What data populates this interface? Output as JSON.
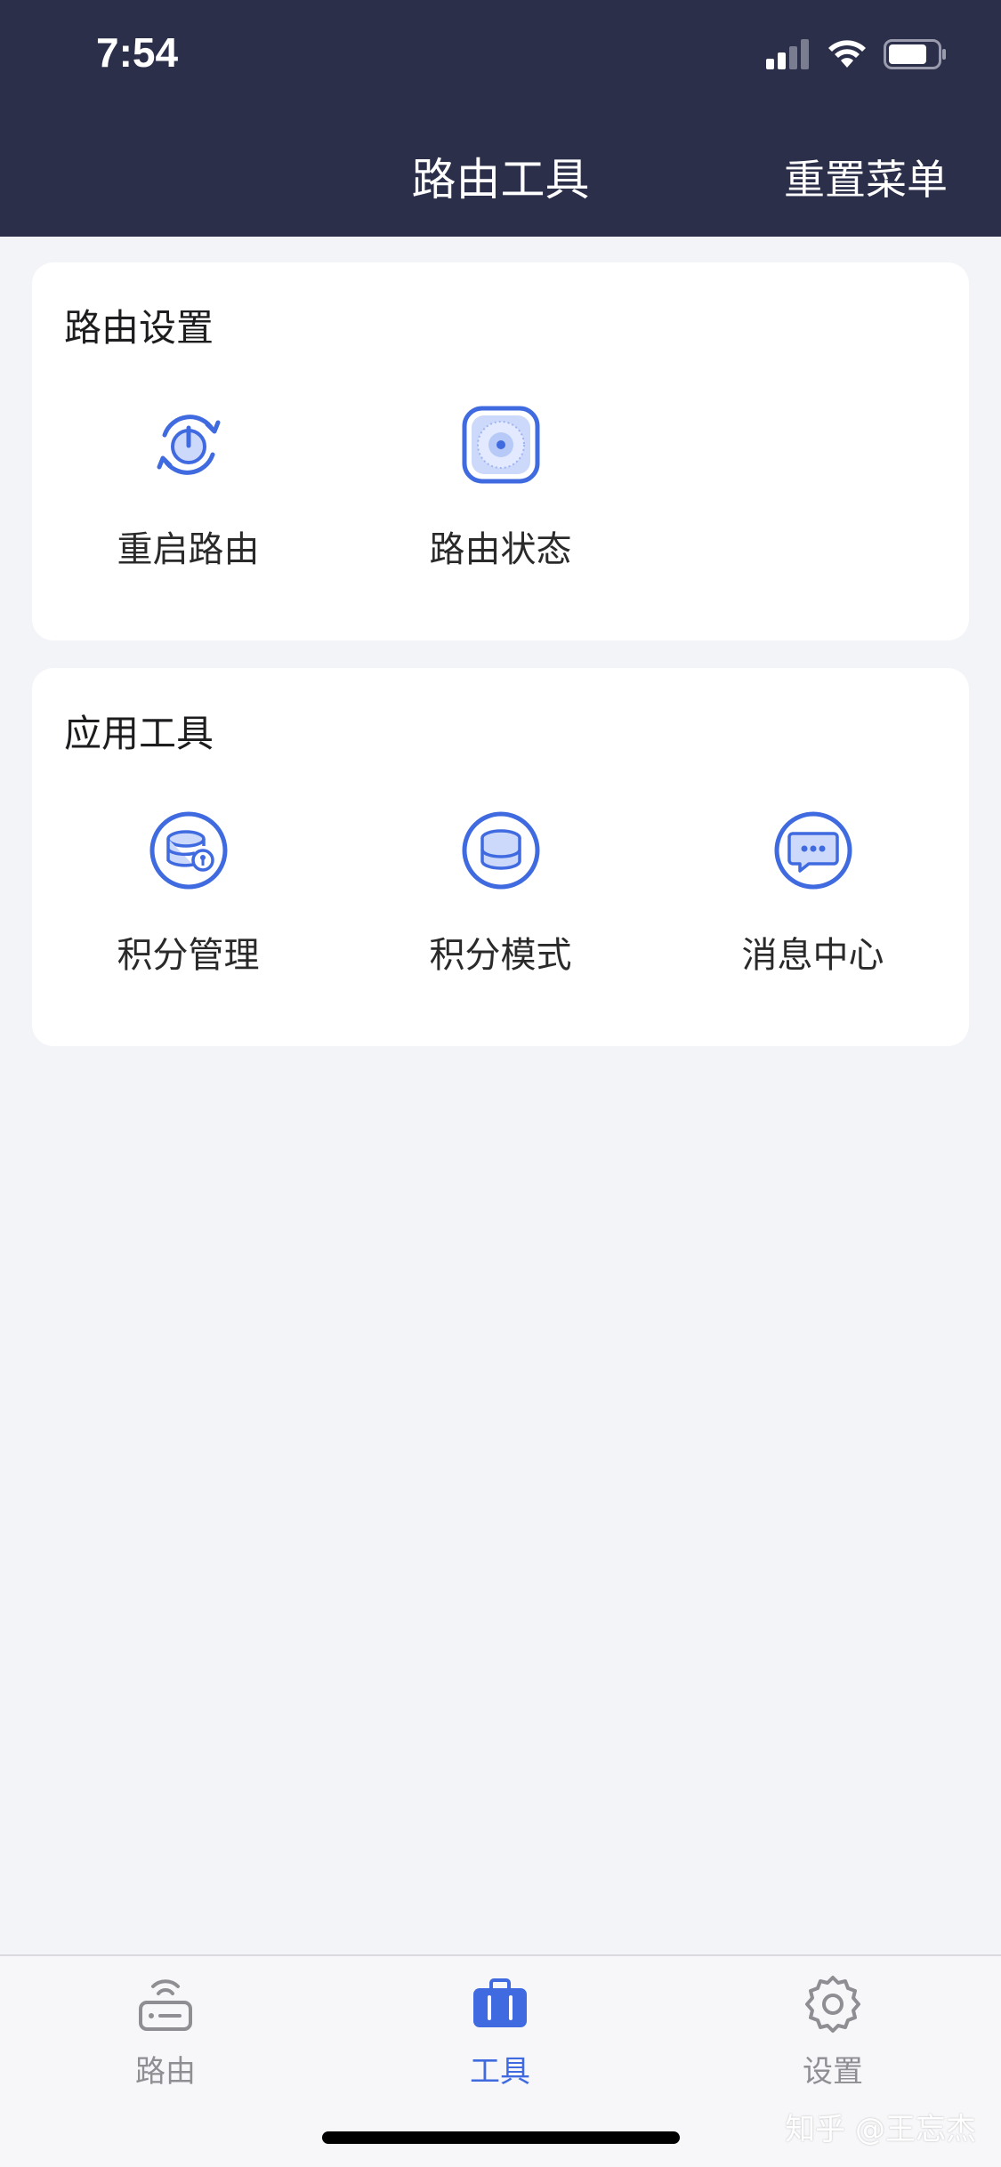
{
  "status_bar": {
    "time": "7:54"
  },
  "nav": {
    "title": "路由工具",
    "right_action": "重置菜单"
  },
  "sections": [
    {
      "title": "路由设置",
      "items": [
        {
          "label": "重启路由",
          "icon": "restart-power-icon"
        },
        {
          "label": "路由状态",
          "icon": "router-status-icon"
        }
      ]
    },
    {
      "title": "应用工具",
      "items": [
        {
          "label": "积分管理",
          "icon": "points-manage-icon"
        },
        {
          "label": "积分模式",
          "icon": "points-mode-icon"
        },
        {
          "label": "消息中心",
          "icon": "message-center-icon"
        }
      ]
    }
  ],
  "tabbar": {
    "tabs": [
      {
        "label": "路由",
        "icon": "router-icon",
        "active": false
      },
      {
        "label": "工具",
        "icon": "toolbox-icon",
        "active": true
      },
      {
        "label": "设置",
        "icon": "gear-icon",
        "active": false
      }
    ]
  },
  "watermark": "知乎 @王忘杰",
  "colors": {
    "header_bg": "#2c2f4a",
    "accent": "#3f6ae0",
    "page_bg": "#f3f4f8",
    "inactive": "#8e8e93"
  }
}
